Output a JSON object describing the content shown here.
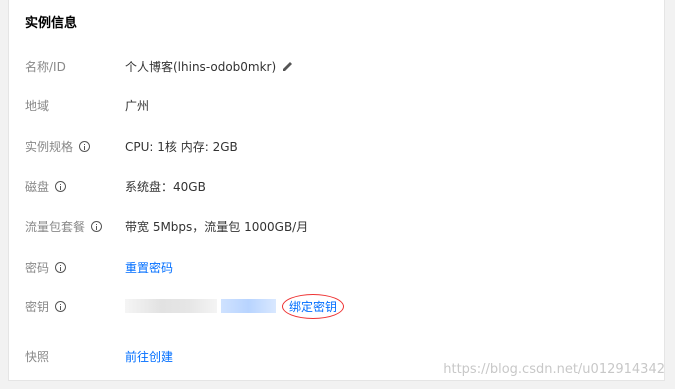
{
  "panel": {
    "title": "实例信息",
    "name": {
      "label": "名称/ID",
      "value": "个人博客(lhins-odob0mkr)"
    },
    "region": {
      "label": "地域",
      "value": "广州"
    },
    "spec": {
      "label": "实例规格",
      "value": "CPU: 1核 内存: 2GB"
    },
    "disk": {
      "label": "磁盘",
      "value": "系统盘：40GB"
    },
    "traffic": {
      "label": "流量包套餐",
      "value": "带宽 5Mbps，流量包 1000GB/月"
    },
    "password": {
      "label": "密码",
      "link": "重置密码"
    },
    "key": {
      "label": "密钥",
      "link": "绑定密钥"
    },
    "snapshot": {
      "label": "快照",
      "link": "前往创建"
    }
  },
  "watermark": "https://blog.csdn.net/u012914342",
  "colors": {
    "link": "#006eff",
    "label": "#888888",
    "value": "#333333",
    "highlight_circle": "#e33333"
  }
}
